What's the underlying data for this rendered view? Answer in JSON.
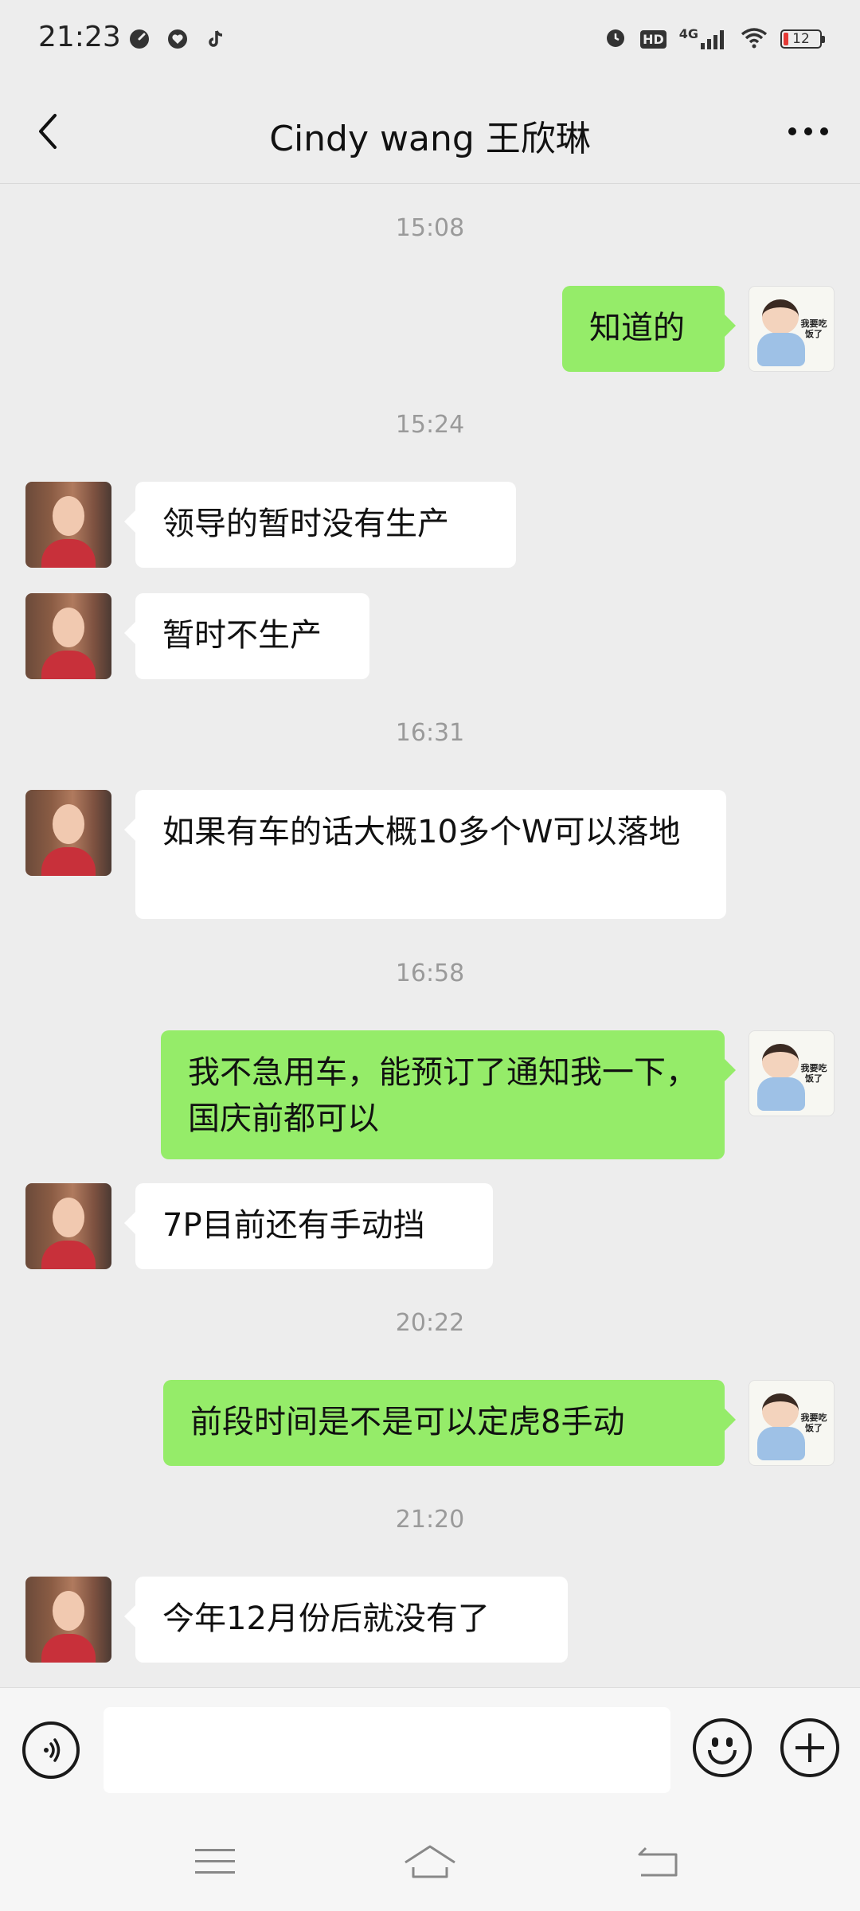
{
  "status_bar": {
    "time": "21:23",
    "network": "4G",
    "hd": "HD",
    "battery": "12",
    "left_icons": [
      "speed-gauge-icon",
      "heart-cloud-icon",
      "tiktok-icon"
    ],
    "right_icons": [
      "alarm-icon",
      "hd-icon",
      "signal-icon",
      "wifi-icon",
      "battery-icon"
    ]
  },
  "header": {
    "title": "Cindy wang 王欣琳",
    "back_icon": "chevron-left-icon",
    "more_icon": "more-dots-icon"
  },
  "messages": {
    "timestamps": [
      "15:08",
      "15:24",
      "16:31",
      "16:58",
      "20:22",
      "21:20"
    ],
    "items": [
      {
        "side": "out",
        "text": "知道的"
      },
      {
        "side": "in",
        "text": "领导的暂时没有生产"
      },
      {
        "side": "in",
        "text": "暂时不生产"
      },
      {
        "side": "in",
        "text": "如果有车的话大概10多个W可以落地"
      },
      {
        "side": "out",
        "text": "我不急用车，能预订了通知我一下，国庆前都可以"
      },
      {
        "side": "in",
        "text": "7P目前还有手动挡"
      },
      {
        "side": "out",
        "text": "前段时间是不是可以定虎8手动"
      },
      {
        "side": "in",
        "text": "今年12月份后就没有了"
      }
    ],
    "my_avatar_caption": "我要吃饭了"
  },
  "input_bar": {
    "value": "",
    "icons": [
      "voice-icon",
      "emoji-icon",
      "plus-icon"
    ]
  },
  "nav_bar": {
    "icons": [
      "menu-icon",
      "home-icon",
      "back-icon"
    ]
  },
  "colors": {
    "background": "#ededed",
    "outgoing_bubble": "#95ec69",
    "incoming_bubble": "#ffffff",
    "timestamp": "#9a9a9a"
  }
}
